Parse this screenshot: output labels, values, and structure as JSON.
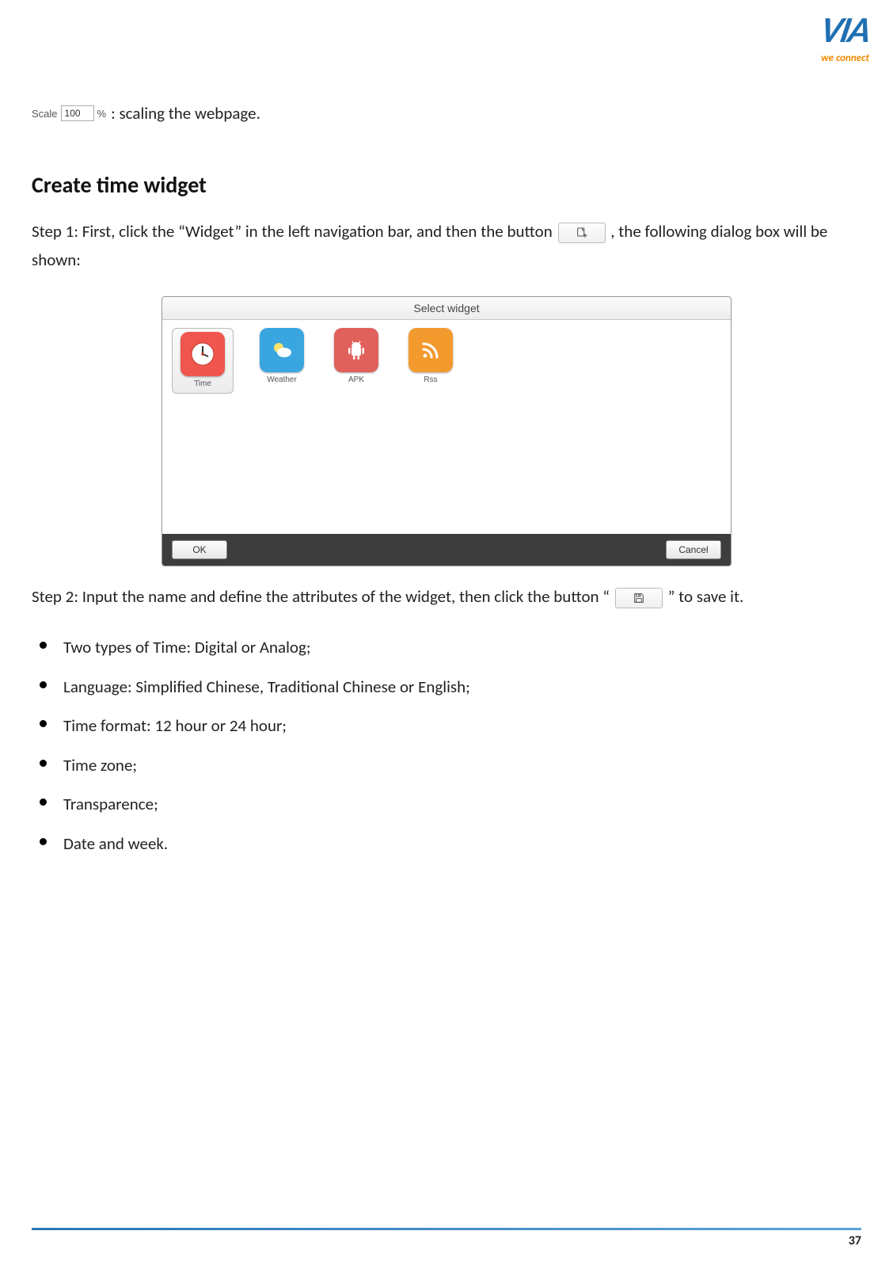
{
  "logo": {
    "brand": "VIA",
    "tagline": "we connect"
  },
  "scale": {
    "label": "Scale",
    "value": "100",
    "suffix": "%",
    "description": " : scaling the webpage."
  },
  "section_heading": "Create time widget",
  "step1": {
    "pre": "Step 1: First, click the “Widget” in the left navigation bar, and then the button",
    "post": ", the following dialog box will be shown:"
  },
  "dialog": {
    "title": "Select widget",
    "widgets": [
      {
        "key": "time",
        "label": "Time",
        "selected": true
      },
      {
        "key": "weather",
        "label": "Weather",
        "selected": false
      },
      {
        "key": "apk",
        "label": "APK",
        "selected": false
      },
      {
        "key": "rss",
        "label": "Rss",
        "selected": false
      }
    ],
    "ok": "OK",
    "cancel": "Cancel"
  },
  "step2": {
    "pre": "Step 2: Input the name and define the attributes of the widget, then click the button “",
    "post": "” to save it."
  },
  "bullets": [
    "Two types of Time: Digital or Analog;",
    "Language: Simplified Chinese, Traditional Chinese or English;",
    "Time format: 12 hour or 24 hour;",
    "Time zone;",
    "Transparence;",
    "Date and week."
  ],
  "page_number": "37"
}
